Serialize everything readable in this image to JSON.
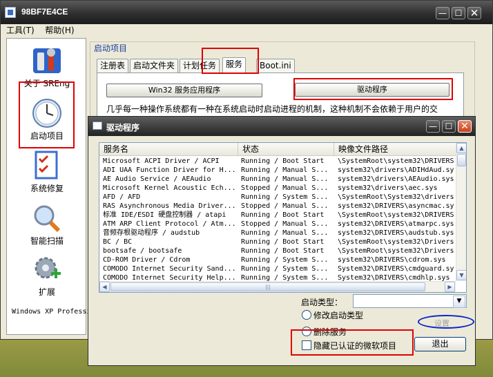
{
  "main_window": {
    "title": "98BF7E4CE",
    "menu": [
      "工具(T)",
      "帮助(H)"
    ],
    "caption_buttons": {
      "minimize": "—",
      "maximize": "☐",
      "close": "✕"
    }
  },
  "sidebar": {
    "items": [
      {
        "label": "关于 SREng",
        "icon": "tools-icon"
      },
      {
        "label": "启动项目",
        "icon": "clock-icon"
      },
      {
        "label": "系统修复",
        "icon": "checklist-icon"
      },
      {
        "label": "智能扫描",
        "icon": "magnifier-icon"
      },
      {
        "label": "扩展",
        "icon": "gear-plus-icon"
      }
    ],
    "status": "Windows XP Professional"
  },
  "content": {
    "group_title": "启动项目",
    "tabs": [
      "注册表",
      "启动文件夹",
      "计划任务",
      "服务",
      "Boot.ini"
    ],
    "active_tab": "服务",
    "buttons": {
      "win32": "Win32 服务应用程序",
      "driver": "驱动程序"
    },
    "description": "几乎每一种操作系统都有一种在系统启动时启动进程的机制，这种机制不会依赖于用户的交"
  },
  "dialog": {
    "title": "驱动程序",
    "caption_buttons": {
      "minimize": "—",
      "maximize": "☐",
      "close": "✕"
    },
    "columns": [
      "服务名",
      "状态",
      "映像文件路径"
    ],
    "rows": [
      [
        "Microsoft ACPI Driver / ACPI",
        "Running / Boot Start",
        "\\SystemRoot\\system32\\DRIVERS"
      ],
      [
        "ADI UAA Function Driver for H...",
        "Running / Manual S...",
        "system32\\drivers\\ADIHdAud.sy"
      ],
      [
        "AE Audio Service / AEAudio",
        "Running / Manual S...",
        "system32\\drivers\\AEAudio.sys"
      ],
      [
        "Microsoft Kernel Acoustic Ech...",
        "Stopped / Manual S...",
        "system32\\drivers\\aec.sys"
      ],
      [
        "AFD / AFD",
        "Running / System S...",
        "\\SystemRoot\\System32\\drivers"
      ],
      [
        "RAS Asynchronous Media Driver...",
        "Stopped / Manual S...",
        "system32\\DRIVERS\\asyncmac.sy"
      ],
      [
        "标准 IDE/ESDI 硬盘控制器 / atapi",
        "Running / Boot Start",
        "\\SystemRoot\\system32\\DRIVERS"
      ],
      [
        "ATM ARP Client Protocol / Atm...",
        "Stopped / Manual S...",
        "system32\\DRIVERS\\atmarpc.sys"
      ],
      [
        "音频存根驱动程序 / audstub",
        "Running / Manual S...",
        "system32\\DRIVERS\\audstub.sys"
      ],
      [
        "BC / BC",
        "Running / Boot Start",
        "\\SystemRoot\\system32\\Drivers"
      ],
      [
        "bootsafe / bootsafe",
        "Running / Boot Start",
        "\\SystemRoot\\system32\\Drivers"
      ],
      [
        "CD-ROM Driver / Cdrom",
        "Running / System S...",
        "system32\\DRIVERS\\cdrom.sys"
      ],
      [
        "COMODO Internet Security Sand...",
        "Running / System S...",
        "System32\\DRIVERS\\cmdguard.sy"
      ],
      [
        "COMODO Internet Security Help...",
        "Running / System S...",
        "System32\\DRIVERS\\cmdhlp.sys"
      ]
    ],
    "hscroll_grip": "|||",
    "startup_type_label": "启动类型：",
    "startup_type_value": "",
    "radio_modify": "修改启动类型",
    "radio_delete": "删除服务",
    "checkbox_hide_ms": "隐藏已认证的微软项目",
    "set_button": "设置",
    "exit_button": "退出"
  },
  "colors": {
    "annotation_red": "#e00000",
    "annotation_blue": "#0b26c8",
    "group_title": "#1c3fa0"
  }
}
